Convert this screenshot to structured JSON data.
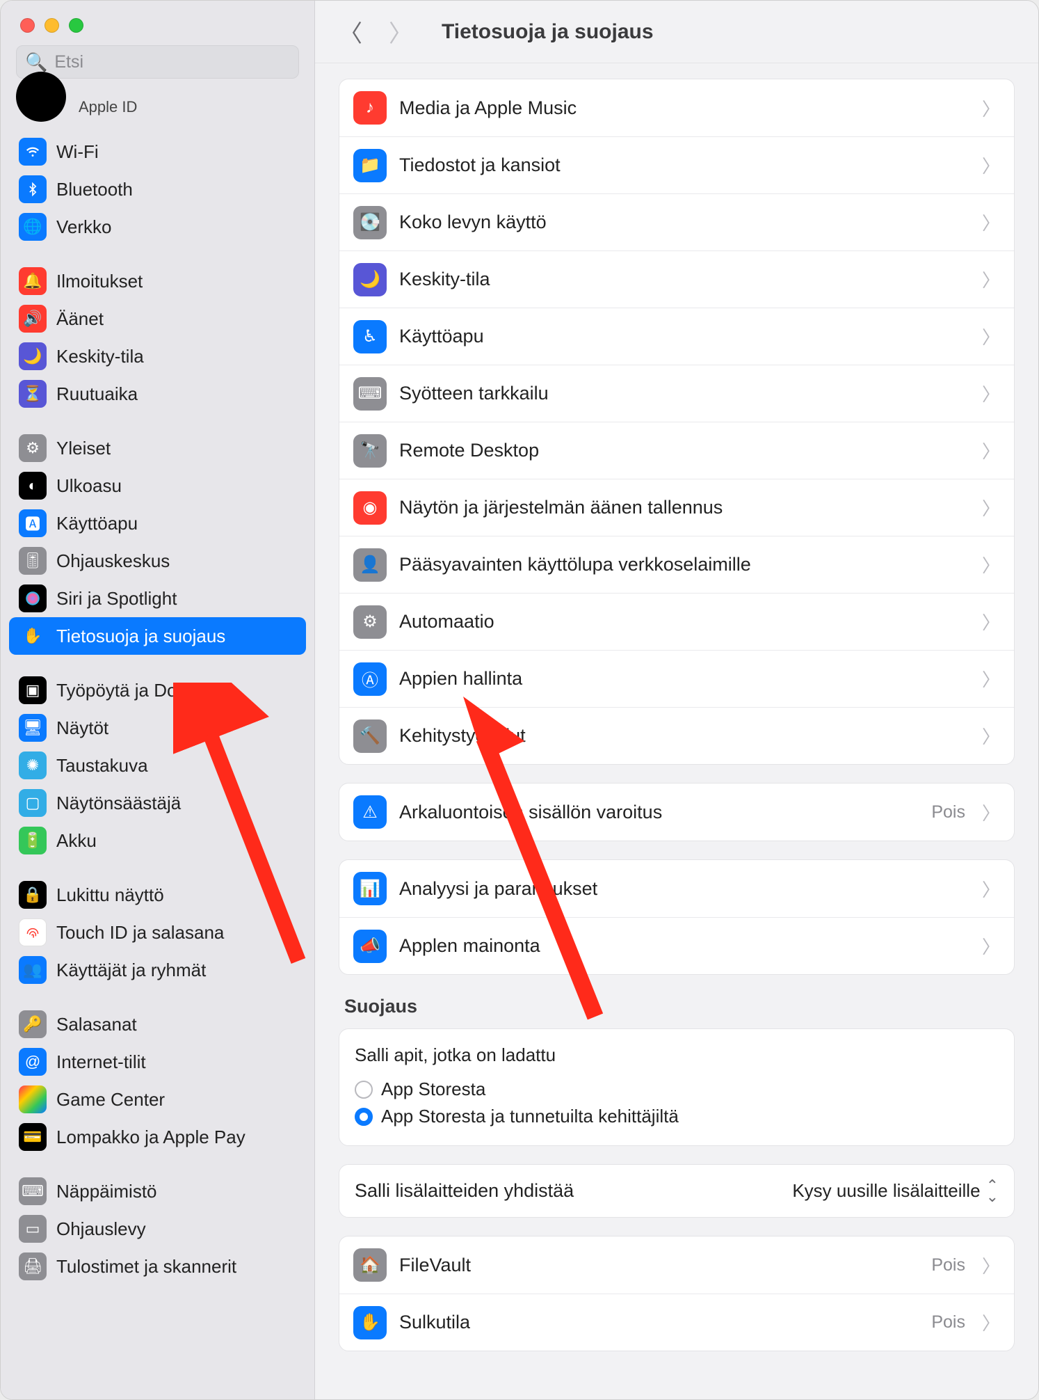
{
  "search": {
    "placeholder": "Etsi"
  },
  "apple_id": {
    "label": "Apple ID"
  },
  "sidebar": {
    "groups": [
      [
        {
          "label": "Wi-Fi"
        },
        {
          "label": "Bluetooth"
        },
        {
          "label": "Verkko"
        }
      ],
      [
        {
          "label": "Ilmoitukset"
        },
        {
          "label": "Äänet"
        },
        {
          "label": "Keskity-tila"
        },
        {
          "label": "Ruutuaika"
        }
      ],
      [
        {
          "label": "Yleiset"
        },
        {
          "label": "Ulkoasu"
        },
        {
          "label": "Käyttöapu"
        },
        {
          "label": "Ohjauskeskus"
        },
        {
          "label": "Siri ja Spotlight"
        },
        {
          "label": "Tietosuoja ja suojaus"
        }
      ],
      [
        {
          "label": "Työpöytä ja Dock"
        },
        {
          "label": "Näytöt"
        },
        {
          "label": "Taustakuva"
        },
        {
          "label": "Näytönsäästäjä"
        },
        {
          "label": "Akku"
        }
      ],
      [
        {
          "label": "Lukittu näyttö"
        },
        {
          "label": "Touch ID ja salasana"
        },
        {
          "label": "Käyttäjät ja ryhmät"
        }
      ],
      [
        {
          "label": "Salasanat"
        },
        {
          "label": "Internet-tilit"
        },
        {
          "label": "Game Center"
        },
        {
          "label": "Lompakko ja Apple Pay"
        }
      ],
      [
        {
          "label": "Näppäimistö"
        },
        {
          "label": "Ohjauslevy"
        },
        {
          "label": "Tulostimet ja skannerit"
        }
      ]
    ]
  },
  "header": {
    "title": "Tietosuoja ja suojaus"
  },
  "main": {
    "group1": [
      {
        "label": "Media ja Apple Music"
      },
      {
        "label": "Tiedostot ja kansiot"
      },
      {
        "label": "Koko levyn käyttö"
      },
      {
        "label": "Keskity-tila"
      },
      {
        "label": "Käyttöapu"
      },
      {
        "label": "Syötteen tarkkailu"
      },
      {
        "label": "Remote Desktop"
      },
      {
        "label": "Näytön ja järjestelmän äänen tallennus"
      },
      {
        "label": "Pääsyavainten käyttölupa verkkoselaimille"
      },
      {
        "label": "Automaatio"
      },
      {
        "label": "Appien hallinta"
      },
      {
        "label": "Kehitystyökalut"
      }
    ],
    "group2": [
      {
        "label": "Arkaluontoisen sisällön varoitus",
        "value": "Pois"
      }
    ],
    "group3": [
      {
        "label": "Analyysi ja parannukset"
      },
      {
        "label": "Applen mainonta"
      }
    ],
    "section_suojaus": "Suojaus",
    "allow_apps": {
      "label": "Salli apit, jotka on ladattu",
      "opt1": "App Storesta",
      "opt2": "App Storesta ja tunnetuilta kehittäjiltä"
    },
    "accessories": {
      "label": "Salli lisälaitteiden yhdistää",
      "value": "Kysy uusille lisälaitteille"
    },
    "group4": [
      {
        "label": "FileVault",
        "value": "Pois"
      },
      {
        "label": "Sulkutila",
        "value": "Pois"
      }
    ]
  }
}
